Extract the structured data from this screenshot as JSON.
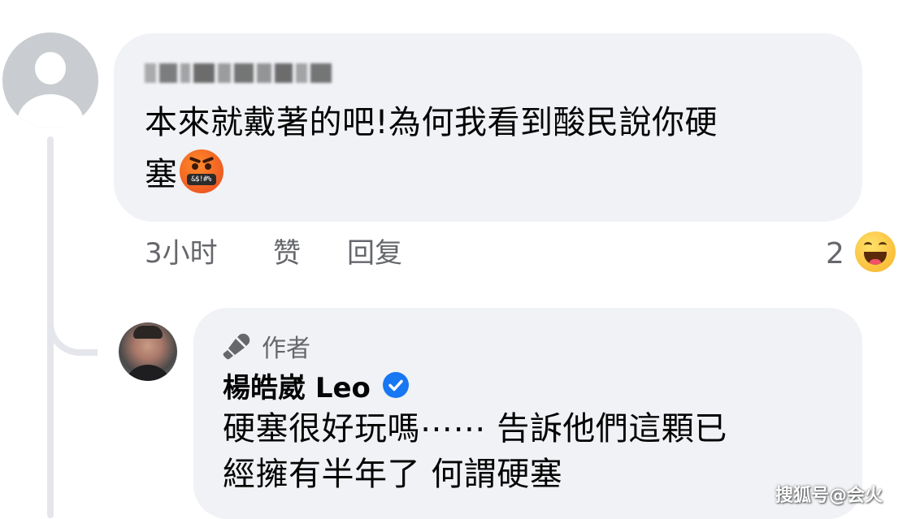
{
  "comment": {
    "author_name": "",
    "text_line1": "本來就戴著的吧!為何我看到酸民說你硬",
    "text_line2": "塞",
    "emoji": "face-with-symbols-on-mouth",
    "emoji_symbols": "&$!#%",
    "time": "3小时",
    "like_label": "赞",
    "reply_label": "回复",
    "reaction_count": "2",
    "reaction_icon": "laughing-face-emoji"
  },
  "reply": {
    "badge_label": "作者",
    "badge_icon": "microphone-icon",
    "author_name": "楊皓崴 Leo",
    "verified_icon": "verified-badge-icon",
    "text_line1": "硬塞很好玩嗎⋯⋯ 告訴他們這顆已",
    "text_line2": "經擁有半年了 何謂硬塞"
  },
  "watermark": "搜狐号@会火",
  "colors": {
    "bubble": "#f0f2f5",
    "secondary_text": "#65676b",
    "verified_blue": "#1877f2",
    "thread_line": "#e4e6eb"
  }
}
